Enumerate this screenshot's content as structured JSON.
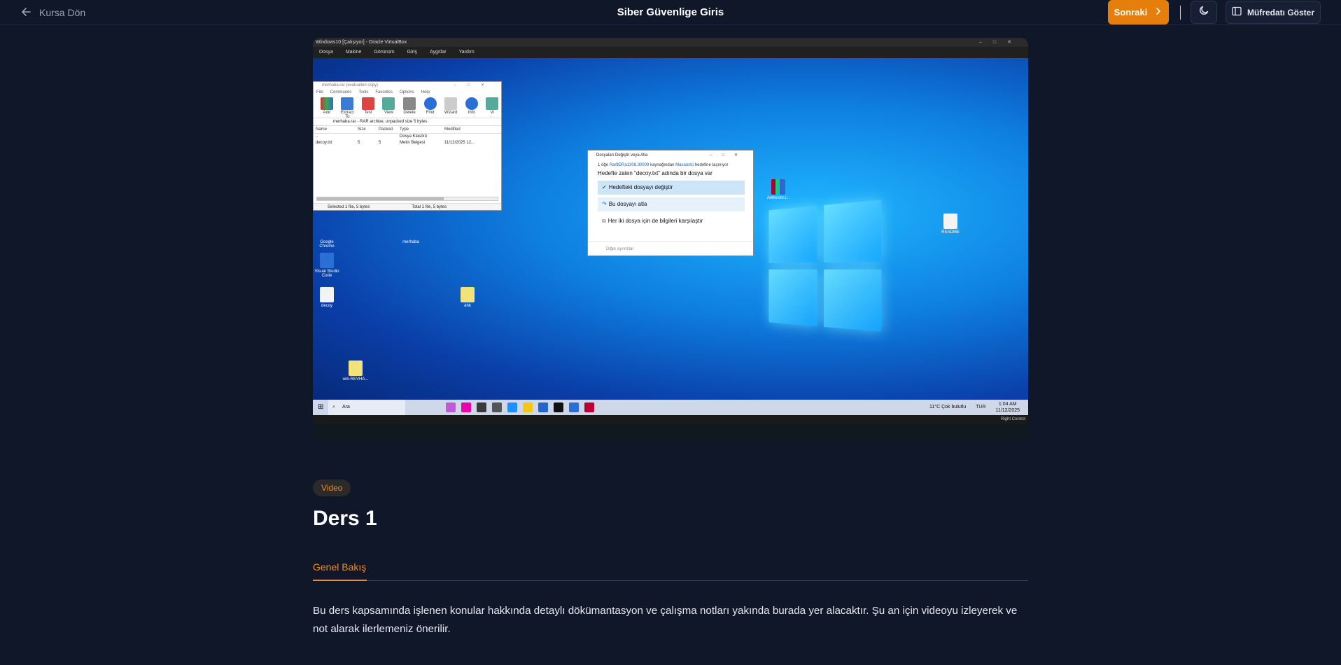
{
  "header": {
    "back_label": "Kursa Dön",
    "title": "Siber Güvenlige Giris",
    "next_label": "Sonraki",
    "curriculum_label": "Müfredatı Göster"
  },
  "video": {
    "vbox_title": "Windows10 [Çalışıyor] - Oracle VirtualBox",
    "vbox_menu": [
      "Dosya",
      "Makine",
      "Görünüm",
      "Giriş",
      "Aygıtlar",
      "Yardım"
    ],
    "winrar": {
      "title": "merhaba.rar (evaluation copy)",
      "menu": [
        "File",
        "Commands",
        "Tools",
        "Favorites",
        "Options",
        "Help"
      ],
      "tools": [
        "Add",
        "Extract To",
        "Test",
        "View",
        "Delete",
        "Find",
        "Wizard",
        "Info",
        "Vi"
      ],
      "path": "merhaba.rar - RAR archive, unpacked size 5 bytes",
      "columns": [
        "Name",
        "Size",
        "Packed",
        "Type",
        "Modified"
      ],
      "rows": [
        [
          "..",
          "",
          "",
          "Dosya Klasörü",
          ""
        ],
        [
          "decoy.txt",
          "5",
          "5",
          "Metin Belgesi",
          "11/12/2025 12..."
        ]
      ],
      "status_left": "Selected 1 file, 5 bytes",
      "status_right": "Total 1 file, 5 bytes"
    },
    "dialog": {
      "title": "Dosyaları Değiştir veya Atla",
      "subtitle_pre": "1 öğe",
      "subtitle_src": "Rar$DRa1308.30009",
      "subtitle_mid": "kaynağından",
      "subtitle_dst": "Masaüstü",
      "subtitle_post": "hedefine taşınıyor",
      "heading": "Hedefte zaten \"decoy.txt\" adında bir dosya var",
      "options": [
        "Hedefteki dosyayı değiştir",
        "Bu dosyayı atla",
        "Her iki dosya için de bilgileri karşılaştır"
      ],
      "more": "Diğer ayrıntılar"
    },
    "desktop_icons": [
      "Google Chrome",
      "merhaba",
      "Visual Studio Code",
      "decoy",
      "ahk",
      "win-REVHA...",
      "Antiwisto.r...",
      "README"
    ],
    "taskbar": {
      "search": "Ara",
      "weather": "11°C  Çok bulutlu",
      "lang": "TUR",
      "time": "1:04 AM",
      "date": "11/12/2025"
    },
    "vbox_status": "Right Control"
  },
  "content": {
    "badge": "Video",
    "lesson_title": "Ders 1",
    "tab_overview": "Genel Bakış",
    "description": "Bu ders kapsamında işlenen konular hakkında detaylı dökümantasyon ve çalışma notları yakında burada yer alacaktır. Şu an için videoyu izleyerek ve not alarak ilerlemeniz önerilir."
  },
  "colors": {
    "background": "#0f1729",
    "accent": "#e67e0c",
    "accent_text": "#f0892b"
  }
}
